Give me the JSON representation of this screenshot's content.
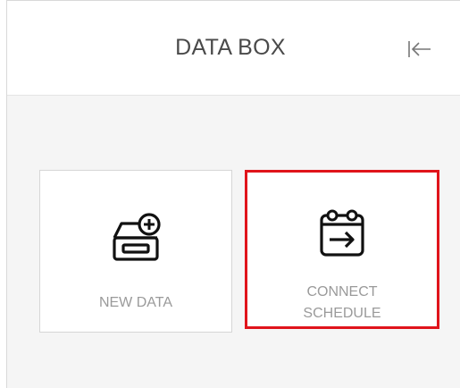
{
  "header": {
    "title": "DATA BOX",
    "collapse_icon": "collapse-left-icon"
  },
  "cards": [
    {
      "label": "NEW DATA",
      "icon": "add-box-icon"
    },
    {
      "label_line1": "CONNECT",
      "label_line2": "SCHEDULE",
      "icon": "calendar-arrow-icon",
      "selected": true
    }
  ],
  "colors": {
    "highlight": "#e0141b",
    "label": "#9a9a9a",
    "title": "#4a4a4a",
    "background": "#f5f5f5"
  }
}
